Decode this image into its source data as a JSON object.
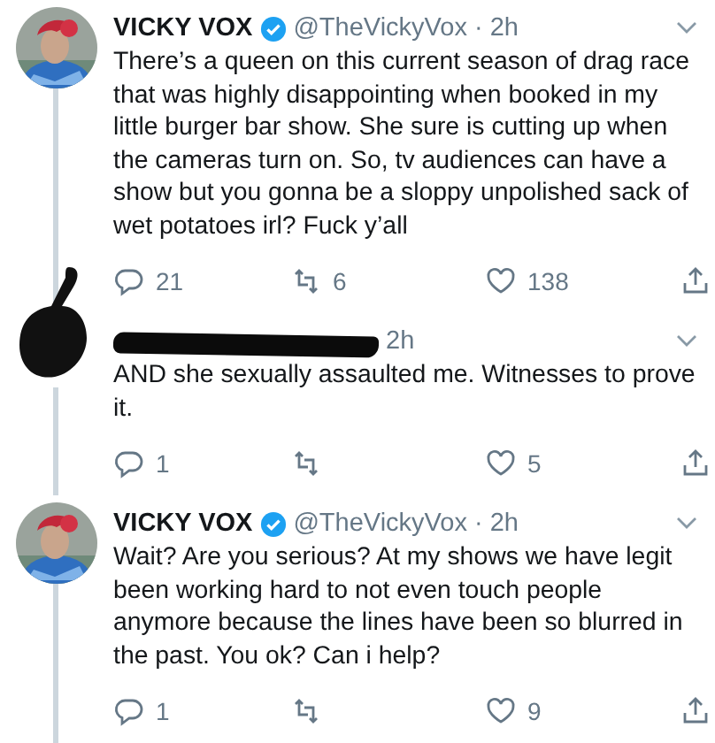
{
  "tweets": [
    {
      "redacted": false,
      "author": {
        "name": "VICKY VOX",
        "verified": true
      },
      "meta": "@TheVickyVox · 2h",
      "text": "There’s a queen on this current season of drag race that was highly disappointing when booked in my little burger bar show. She sure is cutting up when the cameras turn on. So, tv audiences can have a show but you gonna be a sloppy unpolished sack of wet potatoes irl? Fuck y’all",
      "actions": {
        "replies": "21",
        "retweets": "6",
        "likes": "138"
      }
    },
    {
      "redacted": true,
      "meta": "2h",
      "text": "AND she sexually assaulted me. Witnesses to prove it.",
      "actions": {
        "replies": "1",
        "likes": "5"
      }
    },
    {
      "redacted": false,
      "author": {
        "name": "VICKY VOX",
        "verified": true
      },
      "meta": "@TheVickyVox · 2h",
      "text": "Wait? Are you serious? At my shows we have legit been working hard to not even touch people anymore because the lines have been so blurred in the past. You ok? Can i help?",
      "actions": {
        "replies": "1",
        "likes": "9"
      }
    }
  ]
}
